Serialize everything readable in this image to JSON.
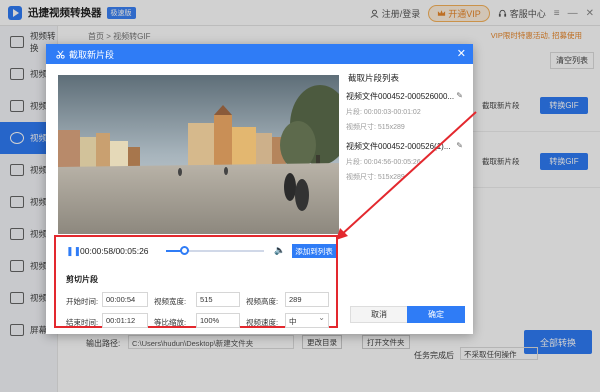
{
  "app": {
    "name": "迅捷视频转换器",
    "edition": "极速版",
    "login": "注册/登录",
    "vip": "开通VIP",
    "support": "客服中心"
  },
  "sidebar": {
    "items": [
      {
        "label": "视频转换",
        "active": false
      },
      {
        "label": "视频",
        "active": false
      },
      {
        "label": "视频",
        "active": false
      },
      {
        "label": "视频",
        "active": true
      },
      {
        "label": "视频",
        "active": false
      },
      {
        "label": "视频",
        "active": false
      },
      {
        "label": "视频",
        "active": false
      },
      {
        "label": "视频",
        "active": false
      },
      {
        "label": "视频",
        "active": false
      },
      {
        "label": "屏幕",
        "active": false
      }
    ]
  },
  "main": {
    "breadcrumb_home": "首页",
    "breadcrumb_sep": ">",
    "breadcrumb_current": "视频转GIF",
    "vip_promo": "VIP限时特惠活动, 招募使用",
    "clear_list": "清空列表",
    "rows": [
      {
        "cut_label": "截取新片段",
        "convert_label": "转换GIF"
      },
      {
        "cut_label": "截取新片段",
        "convert_label": "转换GIF"
      }
    ],
    "output_label": "输出路径:",
    "output_path": "C:\\Users\\hudun\\Desktop\\新建文件夹",
    "change_dir": "更改目录",
    "open_folder": "打开文件夹",
    "convert_all": "全部转换",
    "finish_label": "任务完成后",
    "finish_value": "不采取任何操作"
  },
  "dialog": {
    "title": "截取新片段",
    "list_title": "截取片段列表",
    "segments": [
      {
        "name": "视频文件000452-000526000...",
        "range": "片段: 00:00:03-00:01:02",
        "size": "视频尺寸: 515x289"
      },
      {
        "name": "视频文件000452-000526(1)...",
        "range": "片段: 00:04:56-00:05:26",
        "size": "视频尺寸: 515x289"
      }
    ],
    "time": "00:00:58/00:05:26",
    "progress": 0.18,
    "add_to_list": "添加到列表",
    "clip_title": "剪切片段",
    "start_label": "开始时间:",
    "start_value": "00:00:54",
    "end_label": "结束时间:",
    "end_value": "00:01:12",
    "width_label": "视频宽度:",
    "width_value": "515",
    "scale_label": "等比缩放:",
    "scale_value": "100%",
    "height_label": "视频高度:",
    "height_value": "289",
    "speed_label": "视频速度:",
    "speed_value": "中",
    "cancel": "取消",
    "ok": "确定"
  },
  "colors": {
    "accent": "#2f7cf6",
    "annotation": "#e3282e",
    "vip": "#e8872a"
  }
}
